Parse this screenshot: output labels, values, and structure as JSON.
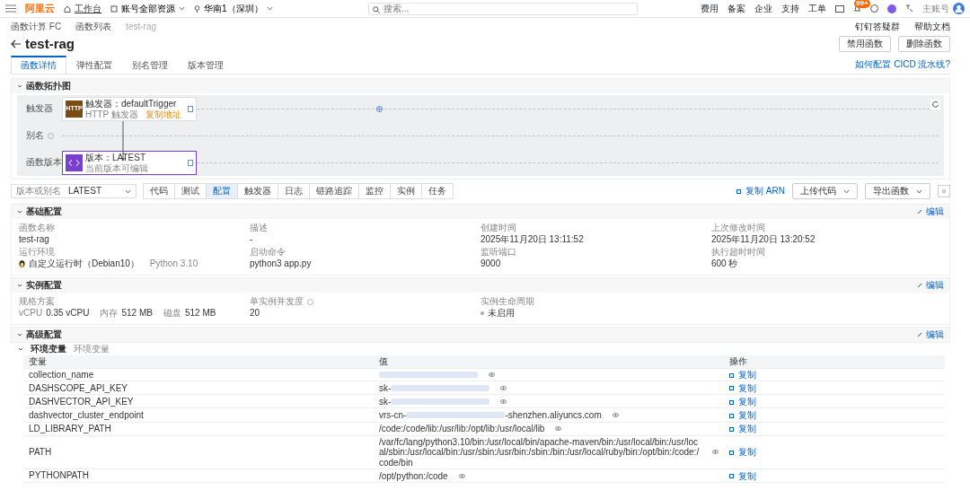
{
  "header": {
    "logo": "阿里云",
    "workbench": "工作台",
    "resource": "账号全部资源",
    "region": "华南1（深圳）",
    "search": {
      "placeholder": "搜索..."
    },
    "links": [
      "费用",
      "备案",
      "企业",
      "支持",
      "工单"
    ],
    "badge": "99+",
    "account": "主账号"
  },
  "breadcrumb": [
    "函数计算 FC",
    "函数列表",
    "test-rag"
  ],
  "top_links": [
    "钉钉答疑群",
    "帮助文档"
  ],
  "title": "test-rag",
  "title_buttons": [
    "禁用函数",
    "删除函数"
  ],
  "page_tabs": [
    {
      "label": "函数详情",
      "selected": true
    },
    {
      "label": "弹性配置",
      "selected": false
    },
    {
      "label": "别名管理",
      "selected": false
    },
    {
      "label": "版本管理",
      "selected": false
    }
  ],
  "cicd_link": "如何配置 CICD 流水线?",
  "topology": {
    "title": "函数拓扑图",
    "expanded": true,
    "lanes": [
      {
        "label": "触发器",
        "help": false,
        "node": {
          "kind": "trigger",
          "badge": "HTTP",
          "title": "触发器：defaultTrigger",
          "subtitle": "HTTP 触发器",
          "link": "复制地址"
        }
      },
      {
        "label": "别名",
        "help": true
      },
      {
        "label": "函数版本",
        "help": false,
        "node": {
          "kind": "version",
          "title": "版本：LATEST",
          "subtitle": "当前版本可编辑"
        }
      }
    ]
  },
  "toolbar": {
    "select_label": "版本或别名",
    "select_value": "LATEST",
    "tabs": [
      {
        "label": "代码",
        "selected": false
      },
      {
        "label": "测试",
        "selected": false
      },
      {
        "label": "配置",
        "selected": true
      },
      {
        "label": "触发器",
        "selected": false
      },
      {
        "label": "日志",
        "selected": false
      },
      {
        "label": "链路追踪",
        "selected": false
      },
      {
        "label": "监控",
        "selected": false
      },
      {
        "label": "实例",
        "selected": false
      },
      {
        "label": "任务",
        "selected": false
      }
    ],
    "copy_arn": "复制 ARN",
    "buttons": [
      "上传代码",
      "导出函数"
    ]
  },
  "sections": [
    {
      "title": "基础配置",
      "edit": "编辑",
      "expanded": true,
      "fields": [
        {
          "label": "函数名称",
          "value": "test-rag"
        },
        {
          "label": "描述",
          "value": "-"
        },
        {
          "label": "创建时间",
          "value": "2025年11月20日 13:11:52"
        },
        {
          "label": "上次修改时间",
          "value": "2025年11月20日 13:20:52"
        },
        {
          "label": "运行环境",
          "kind": "runtime",
          "value": "自定义运行时（Debian10）",
          "note": "Python 3.10"
        },
        {
          "label": "启动命令",
          "value": "python3 app.py"
        },
        {
          "label": "监听端口",
          "value": "9000"
        },
        {
          "label": "执行超时时间",
          "value": "600 秒"
        }
      ]
    },
    {
      "title": "实例配置",
      "edit": "编辑",
      "expanded": true,
      "fields": [
        {
          "label": "规格方案",
          "kind": "spec",
          "parts": [
            {
              "k": "vCPU",
              "v": "0.35 vCPU"
            },
            {
              "k": "内存",
              "v": "512 MB"
            },
            {
              "k": "磁盘",
              "v": "512 MB"
            }
          ]
        },
        {
          "label": "单实例并发度",
          "help": true,
          "value": "20"
        },
        {
          "label": "实例生命周期",
          "kind": "status",
          "value": "未启用",
          "on": false
        }
      ]
    },
    {
      "title": "高级配置",
      "edit": "编辑",
      "expanded": true
    }
  ],
  "env": {
    "title": "环境变量",
    "subtitle": "环境变量",
    "expanded": true,
    "columns": [
      "变量",
      "值",
      "操作"
    ],
    "rows": [
      {
        "name": "collection_name",
        "value": [
          {
            "kind": "redacted"
          }
        ],
        "action": "复制"
      },
      {
        "name": "DASHSCOPE_API_KEY",
        "value": [
          {
            "kind": "text",
            "text": "sk-"
          },
          {
            "kind": "redacted"
          }
        ],
        "action": "复制"
      },
      {
        "name": "DASHVECTOR_API_KEY",
        "value": [
          {
            "kind": "text",
            "text": "sk-"
          },
          {
            "kind": "redacted"
          }
        ],
        "action": "复制"
      },
      {
        "name": "dashvector_cluster_endpoint",
        "value": [
          {
            "kind": "text",
            "text": "vrs-cn-"
          },
          {
            "kind": "redacted"
          },
          {
            "kind": "text",
            "text": "-shenzhen.aliyuncs.com"
          }
        ],
        "action": "复制"
      },
      {
        "name": "LD_LIBRARY_PATH",
        "value": [
          {
            "kind": "text",
            "text": "/code:/code/lib:/usr/lib:/opt/lib:/usr/local/lib"
          }
        ],
        "action": "复制"
      },
      {
        "name": "PATH",
        "value": [
          {
            "kind": "text",
            "text": "/var/fc/lang/python3.10/bin:/usr/local/bin/apache-maven/bin:/usr/local/bin:/usr/local/sbin:/usr/local/bin:/usr/sbin:/usr/bin:/sbin:/bin:/usr/local/ruby/bin:/opt/bin:/code:/code/bin"
          }
        ],
        "action": "复制"
      },
      {
        "name": "PYTHONPATH",
        "value": [
          {
            "kind": "text",
            "text": "/opt/python:/code"
          }
        ],
        "action": "复制"
      }
    ]
  }
}
